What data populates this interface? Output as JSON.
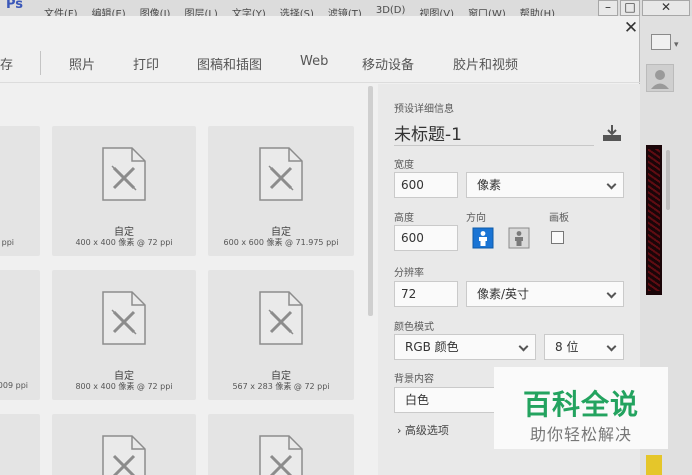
{
  "app": {
    "logo": "Ps",
    "menu": [
      "文件(F)",
      "编辑(E)",
      "图像(I)",
      "图层(L)",
      "文字(Y)",
      "选择(S)",
      "滤镜(T)",
      "3D(D)",
      "视图(V)",
      "窗口(W)",
      "帮助(H)"
    ],
    "window_buttons": [
      "–",
      "□",
      "✕"
    ]
  },
  "dialog": {
    "close": "✕",
    "tabs": [
      {
        "label": "存"
      },
      {
        "label": "照片"
      },
      {
        "label": "打印"
      },
      {
        "label": "图稿和插图"
      },
      {
        "label": "Web"
      },
      {
        "label": "移动设备"
      },
      {
        "label": "胶片和视频"
      }
    ],
    "presets": {
      "rows": [
        [
          {
            "name": "",
            "dims": "2 ppi"
          },
          {
            "name": "自定",
            "dims": "400 x 400 像素 @ 72 ppi"
          },
          {
            "name": "自定",
            "dims": "600 x 600 像素 @ 71.975 ppi"
          }
        ],
        [
          {
            "name": "",
            "dims": "009 ppi"
          },
          {
            "name": "自定",
            "dims": "800 x 400 像素 @ 72 ppi"
          },
          {
            "name": "自定",
            "dims": "567 x 283 像素 @ 72 ppi"
          }
        ]
      ]
    },
    "details": {
      "header": "预设详细信息",
      "doc_title": "未标题-1",
      "width_label": "宽度",
      "width_value": "600",
      "width_unit": "像素",
      "height_label": "高度",
      "height_value": "600",
      "orientation_label": "方向",
      "artboard_label": "画板",
      "resolution_label": "分辨率",
      "resolution_value": "72",
      "resolution_unit": "像素/英寸",
      "color_mode_label": "颜色模式",
      "color_mode_value": "RGB 颜色",
      "bit_depth": "8 位",
      "background_label": "背景内容",
      "background_value": "白色",
      "advanced": "› 高级选项"
    }
  },
  "watermark": {
    "title": "百科全说",
    "subtitle": "助你轻松解决"
  },
  "colors": {
    "accent_blue": "#1a74d4",
    "watermark_green": "#23a35f"
  }
}
